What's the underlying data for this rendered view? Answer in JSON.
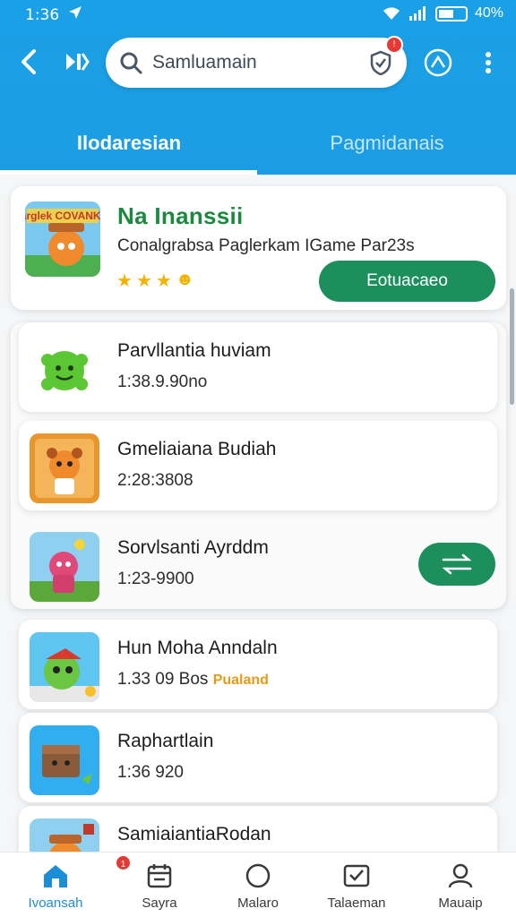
{
  "status_bar": {
    "time": "1:36",
    "battery": "40%"
  },
  "search": {
    "value": "Samluamain"
  },
  "tabs": [
    {
      "label": "Ilodaresian",
      "active": true
    },
    {
      "label": "Pagmidanais",
      "active": false
    }
  ],
  "featured": {
    "title": "Na Inanssii",
    "subtitle": "Conalgrabsa Paglerkam IGame Par23s",
    "stars": 3,
    "action_label": "Eotuacaeo",
    "thumb_text": "Larglek COVANKIN"
  },
  "apps": [
    {
      "name": "Parvllantia huviam",
      "meta": "1:38.9.90no",
      "tag": ""
    },
    {
      "name": "Gmeliaiana Budiah",
      "meta": "2:28:3808",
      "tag": ""
    },
    {
      "name": "Sorvlsanti Ayrddm",
      "meta": "1:23-9900",
      "tag": ""
    },
    {
      "name": "Hun Moha Anndaln",
      "meta": "1.33 09 Bos",
      "tag": "Pualand"
    },
    {
      "name": "Raphartlain",
      "meta": "1:36 920",
      "tag": ""
    },
    {
      "name": "SamiaiantiaRodan",
      "meta": "",
      "tag": ""
    }
  ],
  "bottom_nav": [
    {
      "label": "Ivoansah",
      "icon": "home-icon",
      "active": true
    },
    {
      "label": "Sayra",
      "icon": "calendar-icon",
      "active": false,
      "badge": "1"
    },
    {
      "label": "Malaro",
      "icon": "circle-icon",
      "active": false
    },
    {
      "label": "Talaeman",
      "icon": "inbox-icon",
      "active": false
    },
    {
      "label": "Mauaip",
      "icon": "profile-icon",
      "active": false
    }
  ],
  "colors": {
    "header": "#1c9de3",
    "accent_green": "#1c8f5c",
    "featured_title": "#1b8a3f",
    "badge_red": "#e53935",
    "active_nav": "#1a8ed6"
  }
}
